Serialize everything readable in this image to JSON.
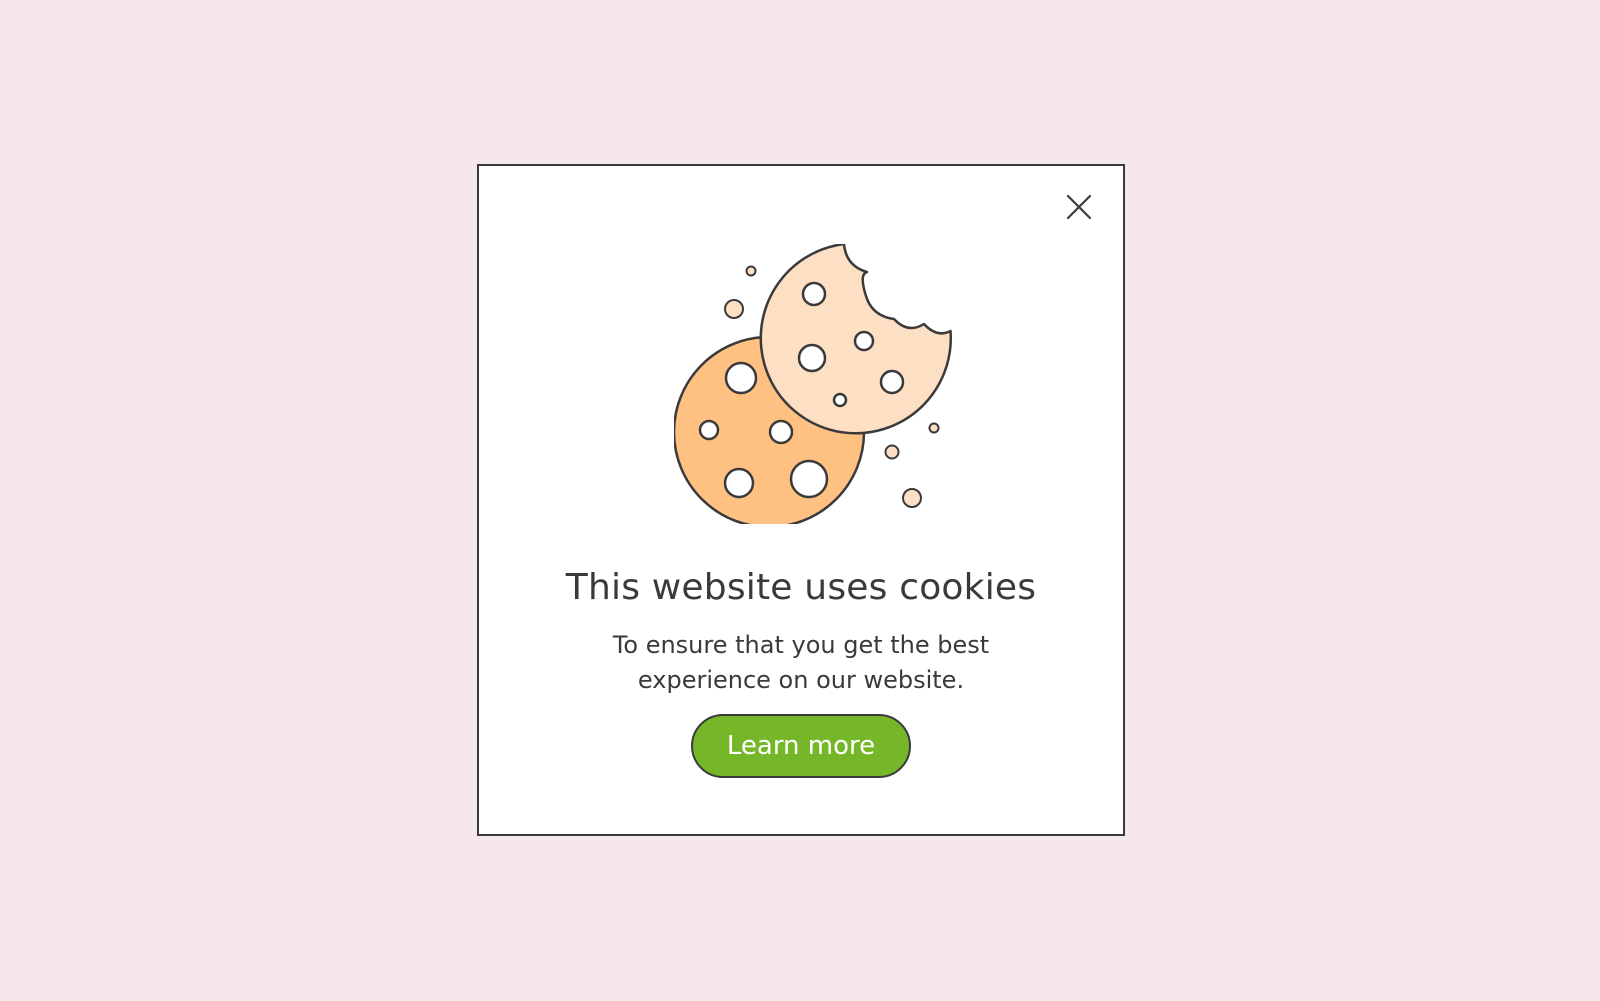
{
  "popup": {
    "title": "This website uses cookies",
    "message": "To ensure that you get the best experience on our website.",
    "cta_label": "Learn more"
  },
  "icons": {
    "close": "close-icon",
    "illustration": "cookies-illustration-icon"
  },
  "colors": {
    "page_background": "#f5e6ee",
    "modal_background": "#ffffff",
    "outline": "#3a3a3c",
    "cta_background": "#76b72a",
    "cta_text": "#ffffff",
    "cookie_front": "#fec182",
    "cookie_back": "#fde0c3"
  }
}
